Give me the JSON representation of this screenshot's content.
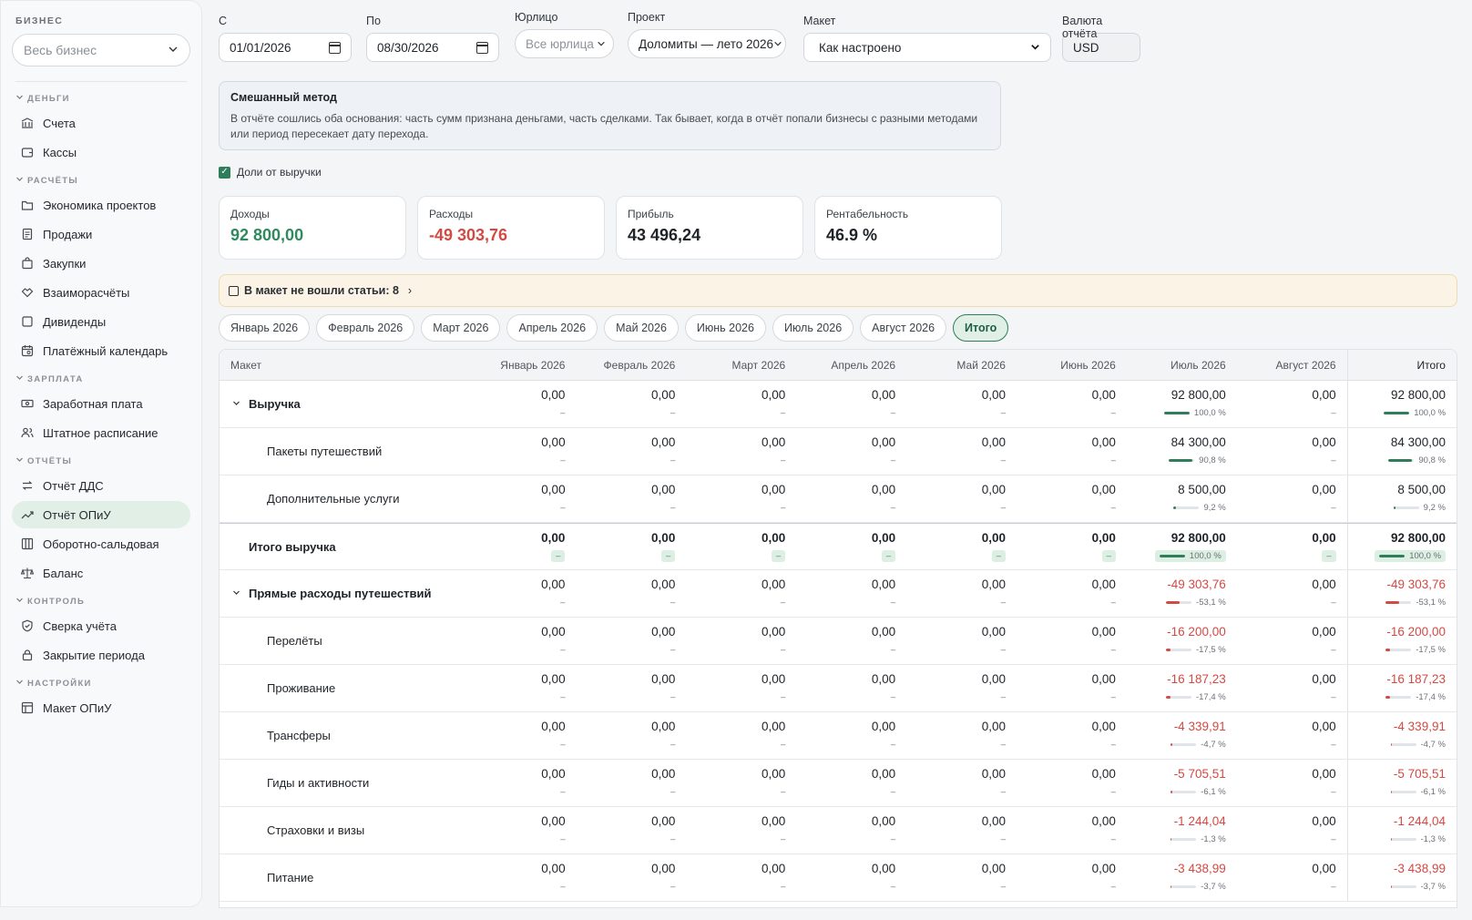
{
  "sidebar": {
    "business_label": "БИЗНЕС",
    "business_select": "Весь бизнес",
    "sections": [
      {
        "title": "ДЕНЬГИ",
        "items": [
          {
            "label": "Счета",
            "icon": "bank-icon"
          },
          {
            "label": "Кассы",
            "icon": "wallet-icon"
          }
        ]
      },
      {
        "title": "РАСЧЁТЫ",
        "items": [
          {
            "label": "Экономика проектов",
            "icon": "folder-icon"
          },
          {
            "label": "Продажи",
            "icon": "receipt-icon"
          },
          {
            "label": "Закупки",
            "icon": "bag-icon"
          },
          {
            "label": "Взаиморасчёты",
            "icon": "handshake-icon"
          },
          {
            "label": "Дивиденды",
            "icon": "square-icon"
          },
          {
            "label": "Платёжный календарь",
            "icon": "calendar-icon"
          }
        ]
      },
      {
        "title": "ЗАРПЛАТА",
        "items": [
          {
            "label": "Заработная плата",
            "icon": "cash-icon"
          },
          {
            "label": "Штатное расписание",
            "icon": "users-icon"
          }
        ]
      },
      {
        "title": "ОТЧЁТЫ",
        "items": [
          {
            "label": "Отчёт ДДС",
            "icon": "arrows-icon"
          },
          {
            "label": "Отчёт ОПиУ",
            "icon": "trend-icon",
            "active": true
          },
          {
            "label": "Оборотно-сальдовая",
            "icon": "columns-icon"
          },
          {
            "label": "Баланс",
            "icon": "scale-icon"
          }
        ]
      },
      {
        "title": "КОНТРОЛЬ",
        "items": [
          {
            "label": "Сверка учёта",
            "icon": "shield-icon"
          },
          {
            "label": "Закрытие периода",
            "icon": "lock-icon"
          }
        ]
      },
      {
        "title": "НАСТРОЙКИ",
        "items": [
          {
            "label": "Макет ОПиУ",
            "icon": "table-icon"
          }
        ]
      }
    ]
  },
  "filters": {
    "from_label": "С",
    "from_value": "01/01/2026",
    "to_label": "По",
    "to_value": "08/30/2026",
    "entity_label": "Юрлицо",
    "entity_value": "Все юрлица",
    "project_label": "Проект",
    "project_value": "Доломиты — лето 2026",
    "layout_label": "Макет",
    "layout_value": "Как настроено",
    "currency_label": "Валюта отчёта",
    "currency_value": "USD"
  },
  "info": {
    "title": "Смешанный метод",
    "text": "В отчёте сошлись оба основания: часть сумм признана деньгами, часть сделками. Так бывает, когда в отчёт попали бизнесы с разными методами или период пересекает дату перехода."
  },
  "share_label": "Доли от выручки",
  "kpis": [
    {
      "label": "Доходы",
      "value": "92 800,00",
      "tone": "green"
    },
    {
      "label": "Расходы",
      "value": "-49 303,76",
      "tone": "red"
    },
    {
      "label": "Прибыль",
      "value": "43 496,24",
      "tone": ""
    },
    {
      "label": "Рентабельность",
      "value": "46.9 %",
      "tone": ""
    }
  ],
  "warning": "В макет не вошли статьи: 8",
  "tabs": [
    "Январь 2026",
    "Февраль 2026",
    "Март 2026",
    "Апрель 2026",
    "Май 2026",
    "Июнь 2026",
    "Июль 2026",
    "Август 2026",
    "Итого"
  ],
  "active_tab": "Итого",
  "table": {
    "name_header": "Макет",
    "columns": [
      "Январь 2026",
      "Февраль 2026",
      "Март 2026",
      "Апрель 2026",
      "Май 2026",
      "Июнь 2026",
      "Июль 2026",
      "Август 2026",
      "Итого"
    ],
    "zero": "0,00",
    "dash": "–",
    "rows": [
      {
        "name": "Выручка",
        "level": 1,
        "expand": true,
        "july": "92 800,00",
        "july_share": "100,0 %",
        "share": 1.0,
        "tone": "pos"
      },
      {
        "name": "Пакеты путешествий",
        "level": 2,
        "july": "84 300,00",
        "july_share": "90,8 %",
        "share": 0.908,
        "tone": "pos"
      },
      {
        "name": "Дополнительные услуги",
        "level": 2,
        "july": "8 500,00",
        "july_share": "9,2 %",
        "share": 0.092,
        "tone": "pos"
      },
      {
        "name": "Итого выручка",
        "level": 1,
        "total": true,
        "july": "92 800,00",
        "july_share": "100,0 %",
        "share": 1.0,
        "tone": "pos"
      },
      {
        "name": "Прямые расходы путешествий",
        "level": 1,
        "expand": true,
        "july": "-49 303,76",
        "july_share": "-53,1 %",
        "share": 0.531,
        "tone": "neg"
      },
      {
        "name": "Перелёты",
        "level": 2,
        "july": "-16 200,00",
        "july_share": "-17,5 %",
        "share": 0.175,
        "tone": "neg"
      },
      {
        "name": "Проживание",
        "level": 2,
        "july": "-16 187,23",
        "july_share": "-17,4 %",
        "share": 0.174,
        "tone": "neg"
      },
      {
        "name": "Трансферы",
        "level": 2,
        "july": "-4 339,91",
        "july_share": "-4,7 %",
        "share": 0.047,
        "tone": "neg"
      },
      {
        "name": "Гиды и активности",
        "level": 2,
        "july": "-5 705,51",
        "july_share": "-6,1 %",
        "share": 0.061,
        "tone": "neg"
      },
      {
        "name": "Страховки и визы",
        "level": 2,
        "july": "-1 244,04",
        "july_share": "-1,3 %",
        "share": 0.013,
        "tone": "neg"
      },
      {
        "name": "Питание",
        "level": 2,
        "july": "-3 438,99",
        "july_share": "-3,7 %",
        "share": 0.037,
        "tone": "neg"
      }
    ]
  },
  "colors": {
    "accent": "#2f7d5b",
    "positive": "#2f8a5e",
    "negative": "#d24a43"
  }
}
